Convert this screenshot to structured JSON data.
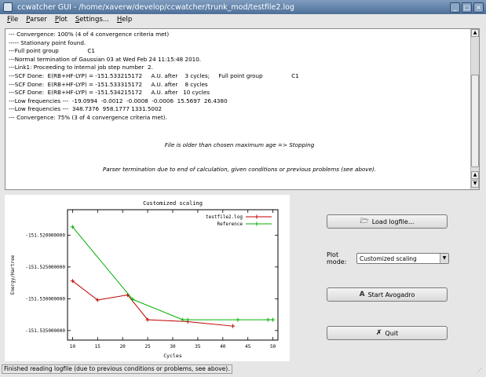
{
  "window": {
    "title": "ccwatcher GUI - /home/xaverw/develop/ccwatcher/trunk_mod/testfile2.log",
    "minimize_glyph": "_",
    "maximize_glyph": "□",
    "close_glyph": "×"
  },
  "menu": {
    "items": [
      {
        "first": "F",
        "rest": "ile"
      },
      {
        "first": "P",
        "rest": "arser"
      },
      {
        "first": "P",
        "rest": "lot"
      },
      {
        "first": "S",
        "rest": "ettings..."
      },
      {
        "first": "H",
        "rest": "elp"
      }
    ]
  },
  "log": {
    "lines": [
      "--- Convergence: 100% (4 of 4 convergence criteria met)",
      "----- Stationary point found.",
      "---Full point group                C1",
      "---Normal termination of Gaussian 03 at Wed Feb 24 11:15:48 2010.",
      "---Link1: Proceeding to internal job step number  2.",
      "---SCF Done:  E(RB+HF-LYP) = -151.533215172     A.U. after    3 cycles;     Full point group                C1",
      "---SCF Done:  E(RB+HF-LYP) = -151.533315172     A.U. after    8 cycles",
      "---SCF Done:  E(RB+HF-LYP) = -151.534215172     A.U. after   10 cycles",
      "---Low frequencies ---  -19.0994  -0.0012  -0.0008  -0.0006  15.5697  26.4380",
      "---Low frequencies ---  348.7376  958.1777 1331.5002",
      "--- Convergence: 75% (3 of 4 convergence criteria met)."
    ],
    "age_notice": "File is older than chosen maximum age => Stopping",
    "termination_notice": "Parser termination due to end of calculation, given conditions or previous problems (see above).",
    "scroll_up_glyph": "▲",
    "scroll_down_glyph": "▼"
  },
  "colors": {
    "series1": "#c00000",
    "series2": "#00b000",
    "accent": "#4d6f98"
  },
  "chart_data": {
    "type": "line",
    "title": "Customized scaling",
    "xlabel": "Cycles",
    "ylabel": "Energy/Hartree",
    "xlim": [
      9,
      51
    ],
    "ylim": [
      -151.5365,
      -151.516
    ],
    "xticks": [
      10,
      15,
      20,
      25,
      30,
      35,
      40,
      45,
      50
    ],
    "yticks": [
      -151.52,
      -151.525,
      -151.53,
      -151.535
    ],
    "ytick_labels": [
      "-151.520000000",
      "-151.525000000",
      "-151.530000000",
      "-151.535000000"
    ],
    "legend_position": "top-right",
    "series": [
      {
        "name": "testfile2.log",
        "color": "#c00000",
        "x": [
          10,
          15,
          21,
          25,
          33,
          42
        ],
        "y": [
          -151.5272,
          -151.5302,
          -151.5294,
          -151.5333,
          -151.5336,
          -151.5343
        ]
      },
      {
        "name": "Reference",
        "color": "#00b000",
        "x": [
          10,
          22,
          32,
          33,
          43,
          49,
          50
        ],
        "y": [
          -151.5187,
          -151.5301,
          -151.5333,
          -151.5333,
          -151.5333,
          -151.5333,
          -151.5333
        ]
      }
    ]
  },
  "controls": {
    "load_label": "Load logfile...",
    "plot_mode_label": "Plot mode:",
    "plot_mode_value": "Customized scaling",
    "avogadro_label": "Start Avogadro",
    "quit_label": "Quit",
    "dropdown_glyph": "▼"
  },
  "status": {
    "text": "Finished reading logfile (due to previous conditions or problems, see above)."
  }
}
